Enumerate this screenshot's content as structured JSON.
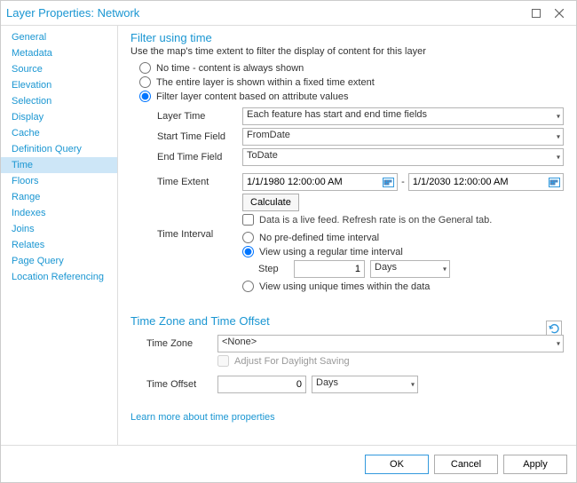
{
  "window": {
    "title": "Layer Properties: Network"
  },
  "sidebar": {
    "items": [
      {
        "label": "General"
      },
      {
        "label": "Metadata"
      },
      {
        "label": "Source"
      },
      {
        "label": "Elevation"
      },
      {
        "label": "Selection"
      },
      {
        "label": "Display"
      },
      {
        "label": "Cache"
      },
      {
        "label": "Definition Query"
      },
      {
        "label": "Time",
        "selected": true
      },
      {
        "label": "Floors"
      },
      {
        "label": "Range"
      },
      {
        "label": "Indexes"
      },
      {
        "label": "Joins"
      },
      {
        "label": "Relates"
      },
      {
        "label": "Page Query"
      },
      {
        "label": "Location Referencing"
      }
    ]
  },
  "filter": {
    "title": "Filter using time",
    "subtitle": "Use the map's time extent to filter the display of content for this layer",
    "opt_none": "No time - content is always shown",
    "opt_fixed": "The entire layer is shown within a fixed time extent",
    "opt_attr": "Filter layer content based on attribute values"
  },
  "form": {
    "layer_time_label": "Layer Time",
    "layer_time_value": "Each feature has start and end time fields",
    "start_label": "Start Time Field",
    "start_value": "FromDate",
    "end_label": "End Time Field",
    "end_value": "ToDate",
    "extent_label": "Time Extent",
    "extent_from": "1/1/1980 12:00:00 AM",
    "extent_to": "1/1/2030 12:00:00 AM",
    "extent_sep": "-",
    "calc_label": "Calculate",
    "live_feed": "Data is a live feed. Refresh rate is on the General tab.",
    "interval_label": "Time Interval",
    "int_none": "No pre-defined time interval",
    "int_regular": "View using a regular time interval",
    "step_label": "Step",
    "step_value": "1",
    "step_unit": "Days",
    "int_unique": "View using unique times within the data"
  },
  "zone": {
    "title": "Time Zone and Time Offset",
    "tz_label": "Time Zone",
    "tz_value": "<None>",
    "dst_label": "Adjust For Daylight Saving",
    "offset_label": "Time Offset",
    "offset_value": "0",
    "offset_unit": "Days"
  },
  "learn_more": "Learn more about time properties",
  "footer": {
    "ok": "OK",
    "cancel": "Cancel",
    "apply": "Apply"
  }
}
